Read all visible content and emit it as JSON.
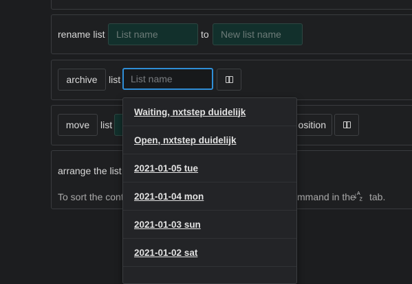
{
  "top_card": {
    "partial_text": ""
  },
  "rename": {
    "label": "rename list",
    "from_placeholder": "List name",
    "to_label": "to",
    "to_placeholder": "New list name"
  },
  "archive": {
    "button": "archive",
    "list_label": "list",
    "placeholder": "List name"
  },
  "move": {
    "button": "move",
    "list_label": "list",
    "position_label": "osition"
  },
  "arrange": {
    "title": "arrange the list",
    "hint_start": "To sort the cont",
    "hint_end": "mmand in the",
    "hint_tab": "tab."
  },
  "dropdown": {
    "items": [
      "Waiting, nxtstep duidelijk",
      "Open, nxtstep duidelijk",
      "2021-01-05 tue",
      "2021-01-04 mon",
      "2021-01-03 sun",
      "2021-01-02 sat"
    ]
  }
}
